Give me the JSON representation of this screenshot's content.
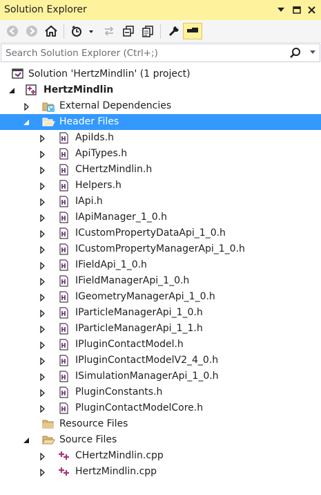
{
  "panel": {
    "title": "Solution Explorer"
  },
  "search": {
    "placeholder": "Search Solution Explorer (Ctrl+;)"
  },
  "tree": {
    "solution": "Solution 'HertzMindlin' (1 project)",
    "project": "HertzMindlin",
    "external_dependencies": "External Dependencies",
    "header_files": {
      "label": "Header Files",
      "items": [
        "ApiIds.h",
        "ApiTypes.h",
        "CHertzMindlin.h",
        "Helpers.h",
        "IApi.h",
        "IApiManager_1_0.h",
        "ICustomPropertyDataApi_1_0.h",
        "ICustomPropertyManagerApi_1_0.h",
        "IFieldApi_1_0.h",
        "IFieldManagerApi_1_0.h",
        "IGeometryManagerApi_1_0.h",
        "IParticleManagerApi_1_0.h",
        "IParticleManagerApi_1_1.h",
        "IPluginContactModel.h",
        "IPluginContactModelV2_4_0.h",
        "ISimulationManagerApi_1_0.h",
        "PluginConstants.h",
        "PluginContactModelCore.h"
      ]
    },
    "resource_files": "Resource Files",
    "source_files": {
      "label": "Source Files",
      "items": [
        "CHertzMindlin.cpp",
        "HertzMindlin.cpp"
      ]
    }
  },
  "colors": {
    "title_bar": "#fff29d",
    "selection": "#3399ff",
    "header_icon": "#68217a",
    "cpp_icon": "#a4377e"
  }
}
